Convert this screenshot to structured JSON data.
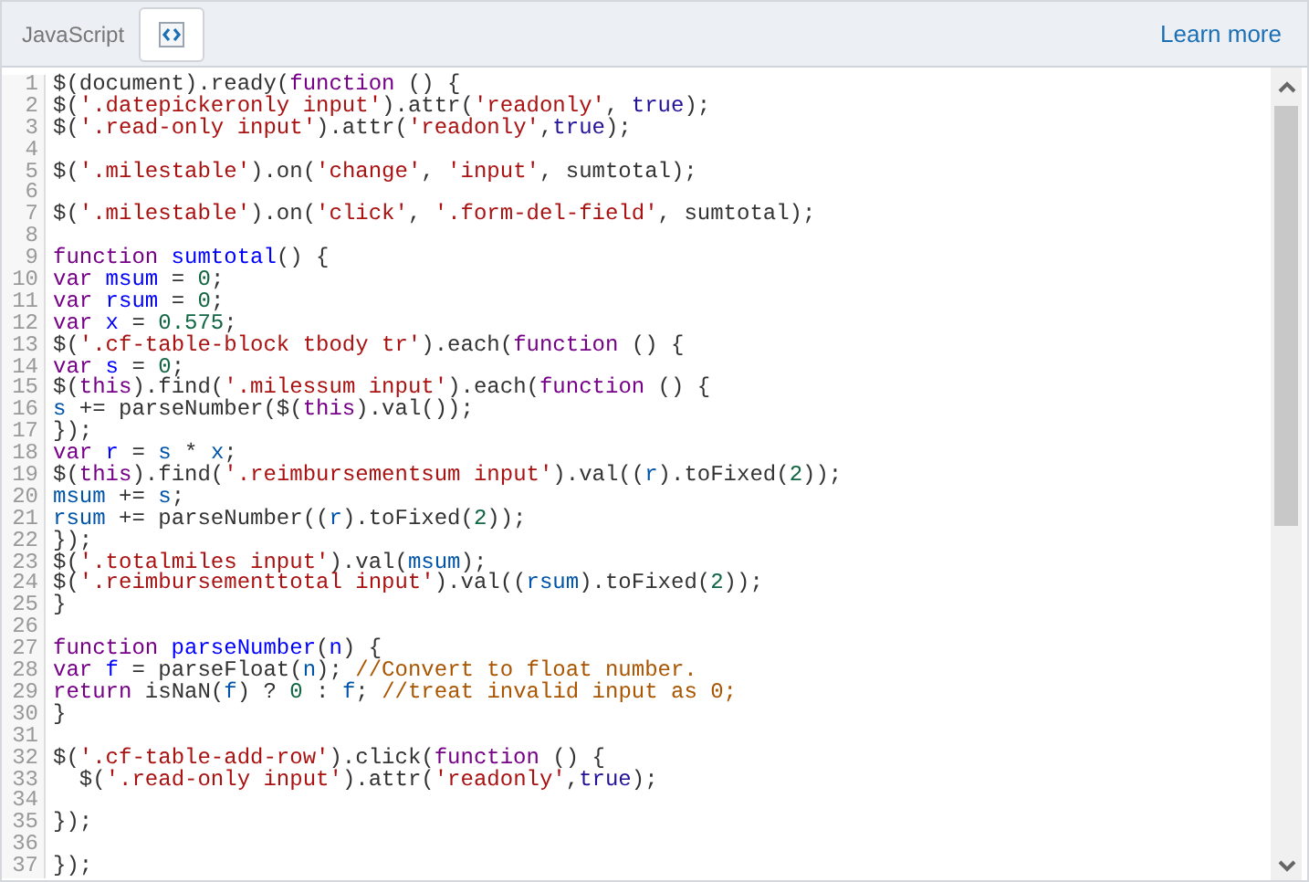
{
  "header": {
    "title": "JavaScript",
    "link": "Learn more"
  },
  "lines": [
    {
      "number": "1",
      "tokens": [
        {
          "t": "$(document).ready(",
          "kind": "plain"
        },
        {
          "t": "function",
          "kind": "keyword"
        },
        {
          "t": " () {",
          "kind": "plain"
        }
      ]
    },
    {
      "number": "2",
      "tokens": [
        {
          "t": "$(",
          "kind": "plain"
        },
        {
          "t": "'.datepickeronly input'",
          "kind": "string"
        },
        {
          "t": ").attr(",
          "kind": "plain"
        },
        {
          "t": "'readonly'",
          "kind": "string"
        },
        {
          "t": ",",
          "kind": "plain"
        },
        {
          "t": " true",
          "kind": "atom"
        },
        {
          "t": ");",
          "kind": "plain"
        }
      ]
    },
    {
      "number": "3",
      "tokens": [
        {
          "t": "$(",
          "kind": "plain"
        },
        {
          "t": "'.read-only input'",
          "kind": "string"
        },
        {
          "t": ").attr(",
          "kind": "plain"
        },
        {
          "t": "'readonly'",
          "kind": "string"
        },
        {
          "t": ",",
          "kind": "plain"
        },
        {
          "t": "true",
          "kind": "atom"
        },
        {
          "t": ");",
          "kind": "plain"
        }
      ]
    },
    {
      "number": "4"
    },
    {
      "number": "5",
      "tokens": [
        {
          "t": "$(",
          "kind": "plain"
        },
        {
          "t": "'.milestable'",
          "kind": "string"
        },
        {
          "t": ").on(",
          "kind": "plain"
        },
        {
          "t": "'change'",
          "kind": "string"
        },
        {
          "t": ",",
          "kind": "plain"
        },
        {
          "t": " 'input'",
          "kind": "string"
        },
        {
          "t": ", sumtotal);",
          "kind": "plain"
        }
      ]
    },
    {
      "number": "6"
    },
    {
      "number": "7",
      "tokens": [
        {
          "t": "$(",
          "kind": "plain"
        },
        {
          "t": "'.milestable'",
          "kind": "string"
        },
        {
          "t": ").on(",
          "kind": "plain"
        },
        {
          "t": "'click'",
          "kind": "string"
        },
        {
          "t": ",",
          "kind": "plain"
        },
        {
          "t": " '.form-del-field'",
          "kind": "string"
        },
        {
          "t": ", sumtotal);",
          "kind": "plain"
        }
      ]
    },
    {
      "number": "8"
    },
    {
      "number": "9",
      "tokens": [
        {
          "t": "function",
          "kind": "keyword"
        },
        {
          "t": " sumtotal",
          "kind": "def"
        },
        {
          "t": "() {",
          "kind": "plain"
        }
      ]
    },
    {
      "number": "10",
      "tokens": [
        {
          "t": "var",
          "kind": "keyword"
        },
        {
          "t": " msum",
          "kind": "def"
        },
        {
          "t": " = ",
          "kind": "plain"
        },
        {
          "t": "0",
          "kind": "number"
        },
        {
          "t": ";",
          "kind": "plain"
        }
      ]
    },
    {
      "number": "11",
      "tokens": [
        {
          "t": "var",
          "kind": "keyword"
        },
        {
          "t": " rsum",
          "kind": "def"
        },
        {
          "t": " = ",
          "kind": "plain"
        },
        {
          "t": "0",
          "kind": "number"
        },
        {
          "t": ";",
          "kind": "plain"
        }
      ]
    },
    {
      "number": "12",
      "tokens": [
        {
          "t": "var",
          "kind": "keyword"
        },
        {
          "t": " x",
          "kind": "def"
        },
        {
          "t": " = ",
          "kind": "plain"
        },
        {
          "t": "0.575",
          "kind": "number"
        },
        {
          "t": ";",
          "kind": "plain"
        }
      ]
    },
    {
      "number": "13",
      "tokens": [
        {
          "t": "$(",
          "kind": "plain"
        },
        {
          "t": "'.cf-table-block tbody tr'",
          "kind": "string"
        },
        {
          "t": ").each(",
          "kind": "plain"
        },
        {
          "t": "function",
          "kind": "keyword"
        },
        {
          "t": " () {",
          "kind": "plain"
        }
      ]
    },
    {
      "number": "14",
      "tokens": [
        {
          "t": "var",
          "kind": "keyword"
        },
        {
          "t": " s",
          "kind": "def"
        },
        {
          "t": " = ",
          "kind": "plain"
        },
        {
          "t": "0",
          "kind": "number"
        },
        {
          "t": ";",
          "kind": "plain"
        }
      ]
    },
    {
      "number": "15",
      "tokens": [
        {
          "t": "$(",
          "kind": "plain"
        },
        {
          "t": "this",
          "kind": "keyword"
        },
        {
          "t": ").find(",
          "kind": "plain"
        },
        {
          "t": "'.milessum input'",
          "kind": "string"
        },
        {
          "t": ").each(",
          "kind": "plain"
        },
        {
          "t": "function",
          "kind": "keyword"
        },
        {
          "t": " () {",
          "kind": "plain"
        }
      ]
    },
    {
      "number": "16",
      "tokens": [
        {
          "t": "s",
          "kind": "variable"
        },
        {
          "t": " += parseNumber($(",
          "kind": "plain"
        },
        {
          "t": "this",
          "kind": "keyword"
        },
        {
          "t": ").val());",
          "kind": "plain"
        }
      ]
    },
    {
      "number": "17",
      "tokens": [
        {
          "t": "});",
          "kind": "plain"
        }
      ]
    },
    {
      "number": "18",
      "tokens": [
        {
          "t": "var",
          "kind": "keyword"
        },
        {
          "t": " r",
          "kind": "def"
        },
        {
          "t": " = ",
          "kind": "plain"
        },
        {
          "t": "s",
          "kind": "variable"
        },
        {
          "t": " * ",
          "kind": "plain"
        },
        {
          "t": "x",
          "kind": "variable"
        },
        {
          "t": ";",
          "kind": "plain"
        }
      ]
    },
    {
      "number": "19",
      "tokens": [
        {
          "t": "$(",
          "kind": "plain"
        },
        {
          "t": "this",
          "kind": "keyword"
        },
        {
          "t": ").find(",
          "kind": "plain"
        },
        {
          "t": "'.reimbursementsum input'",
          "kind": "string"
        },
        {
          "t": ").val((",
          "kind": "plain"
        },
        {
          "t": "r",
          "kind": "variable"
        },
        {
          "t": ").toFixed(",
          "kind": "plain"
        },
        {
          "t": "2",
          "kind": "number"
        },
        {
          "t": "));",
          "kind": "plain"
        }
      ]
    },
    {
      "number": "20",
      "tokens": [
        {
          "t": "msum",
          "kind": "variable"
        },
        {
          "t": " += ",
          "kind": "plain"
        },
        {
          "t": "s",
          "kind": "variable"
        },
        {
          "t": ";",
          "kind": "plain"
        }
      ]
    },
    {
      "number": "21",
      "tokens": [
        {
          "t": "rsum",
          "kind": "variable"
        },
        {
          "t": " += parseNumber((",
          "kind": "plain"
        },
        {
          "t": "r",
          "kind": "variable"
        },
        {
          "t": ").toFixed(",
          "kind": "plain"
        },
        {
          "t": "2",
          "kind": "number"
        },
        {
          "t": "));",
          "kind": "plain"
        }
      ]
    },
    {
      "number": "22",
      "tokens": [
        {
          "t": "});",
          "kind": "plain"
        }
      ]
    },
    {
      "number": "23",
      "tokens": [
        {
          "t": "$(",
          "kind": "plain"
        },
        {
          "t": "'.totalmiles input'",
          "kind": "string"
        },
        {
          "t": ").val(",
          "kind": "plain"
        },
        {
          "t": "msum",
          "kind": "variable"
        },
        {
          "t": ");",
          "kind": "plain"
        }
      ]
    },
    {
      "number": "24",
      "tokens": [
        {
          "t": "$(",
          "kind": "plain"
        },
        {
          "t": "'.reimbursementtotal input'",
          "kind": "string"
        },
        {
          "t": ").val((",
          "kind": "plain"
        },
        {
          "t": "rsum",
          "kind": "variable"
        },
        {
          "t": ").toFixed(",
          "kind": "plain"
        },
        {
          "t": "2",
          "kind": "number"
        },
        {
          "t": "));",
          "kind": "plain"
        }
      ]
    },
    {
      "number": "25",
      "tokens": [
        {
          "t": "}",
          "kind": "plain"
        }
      ]
    },
    {
      "number": "26"
    },
    {
      "number": "27",
      "tokens": [
        {
          "t": "function",
          "kind": "keyword"
        },
        {
          "t": " parseNumber",
          "kind": "def"
        },
        {
          "t": "(",
          "kind": "plain"
        },
        {
          "t": "n",
          "kind": "def"
        },
        {
          "t": ") {",
          "kind": "plain"
        }
      ]
    },
    {
      "number": "28",
      "tokens": [
        {
          "t": "var",
          "kind": "keyword"
        },
        {
          "t": " f",
          "kind": "def"
        },
        {
          "t": " = parseFloat(",
          "kind": "plain"
        },
        {
          "t": "n",
          "kind": "variable"
        },
        {
          "t": "); ",
          "kind": "plain"
        },
        {
          "t": "//Convert to float number.",
          "kind": "comment"
        }
      ]
    },
    {
      "number": "29",
      "tokens": [
        {
          "t": "return",
          "kind": "keyword"
        },
        {
          "t": " isNaN(",
          "kind": "plain"
        },
        {
          "t": "f",
          "kind": "variable"
        },
        {
          "t": ") ? ",
          "kind": "plain"
        },
        {
          "t": "0",
          "kind": "number"
        },
        {
          "t": " : ",
          "kind": "plain"
        },
        {
          "t": "f",
          "kind": "variable"
        },
        {
          "t": "; ",
          "kind": "plain"
        },
        {
          "t": "//treat invalid input as 0;",
          "kind": "comment"
        }
      ]
    },
    {
      "number": "30",
      "tokens": [
        {
          "t": "}",
          "kind": "plain"
        }
      ]
    },
    {
      "number": "31"
    },
    {
      "number": "32",
      "tokens": [
        {
          "t": "$(",
          "kind": "plain"
        },
        {
          "t": "'.cf-table-add-row'",
          "kind": "string"
        },
        {
          "t": ").click(",
          "kind": "plain"
        },
        {
          "t": "function",
          "kind": "keyword"
        },
        {
          "t": " () {",
          "kind": "plain"
        }
      ]
    },
    {
      "number": "33",
      "tokens": [
        {
          "t": "  $(",
          "kind": "plain"
        },
        {
          "t": "'.read-only input'",
          "kind": "string"
        },
        {
          "t": ").attr(",
          "kind": "plain"
        },
        {
          "t": "'readonly'",
          "kind": "string"
        },
        {
          "t": ",",
          "kind": "plain"
        },
        {
          "t": "true",
          "kind": "atom"
        },
        {
          "t": ");",
          "kind": "plain"
        }
      ]
    },
    {
      "number": "34"
    },
    {
      "number": "35",
      "tokens": [
        {
          "t": "});",
          "kind": "plain"
        }
      ]
    },
    {
      "number": "36"
    },
    {
      "number": "37",
      "tokens": [
        {
          "t": "});",
          "kind": "plain"
        }
      ]
    }
  ]
}
